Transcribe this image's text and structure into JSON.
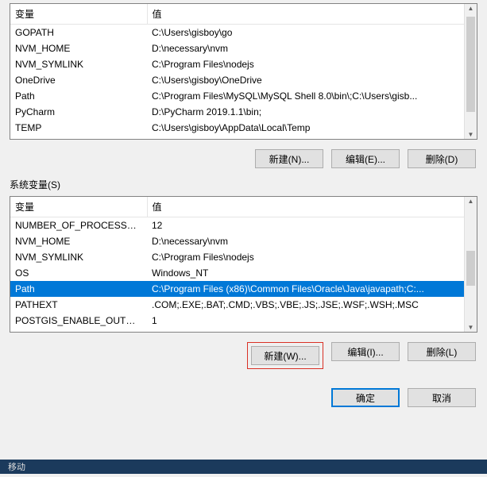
{
  "userVars": {
    "headers": {
      "variable": "变量",
      "value": "值"
    },
    "rows": [
      {
        "name": "GOPATH",
        "value": "C:\\Users\\gisboy\\go"
      },
      {
        "name": "NVM_HOME",
        "value": "D:\\necessary\\nvm"
      },
      {
        "name": "NVM_SYMLINK",
        "value": "C:\\Program Files\\nodejs"
      },
      {
        "name": "OneDrive",
        "value": "C:\\Users\\gisboy\\OneDrive"
      },
      {
        "name": "Path",
        "value": "C:\\Program Files\\MySQL\\MySQL Shell 8.0\\bin\\;C:\\Users\\gisb..."
      },
      {
        "name": "PyCharm",
        "value": "D:\\PyCharm 2019.1.1\\bin;"
      },
      {
        "name": "TEMP",
        "value": "C:\\Users\\gisboy\\AppData\\Local\\Temp"
      }
    ],
    "buttons": {
      "new": "新建(N)...",
      "edit": "编辑(E)...",
      "delete": "删除(D)"
    }
  },
  "systemVars": {
    "label": "系统变量(S)",
    "headers": {
      "variable": "变量",
      "value": "值"
    },
    "rows": [
      {
        "name": "NUMBER_OF_PROCESSORS",
        "value": "12"
      },
      {
        "name": "NVM_HOME",
        "value": "D:\\necessary\\nvm"
      },
      {
        "name": "NVM_SYMLINK",
        "value": "C:\\Program Files\\nodejs"
      },
      {
        "name": "OS",
        "value": "Windows_NT"
      },
      {
        "name": "Path",
        "value": "C:\\Program Files (x86)\\Common Files\\Oracle\\Java\\javapath;C:...",
        "selected": true
      },
      {
        "name": "PATHEXT",
        "value": ".COM;.EXE;.BAT;.CMD;.VBS;.VBE;.JS;.JSE;.WSF;.WSH;.MSC"
      },
      {
        "name": "POSTGIS_ENABLE_OUTDB...",
        "value": "1"
      }
    ],
    "buttons": {
      "new": "新建(W)...",
      "edit": "编辑(I)...",
      "delete": "删除(L)"
    }
  },
  "dialogButtons": {
    "ok": "确定",
    "cancel": "取消"
  },
  "bottomStrip": {
    "tab": "移动"
  }
}
